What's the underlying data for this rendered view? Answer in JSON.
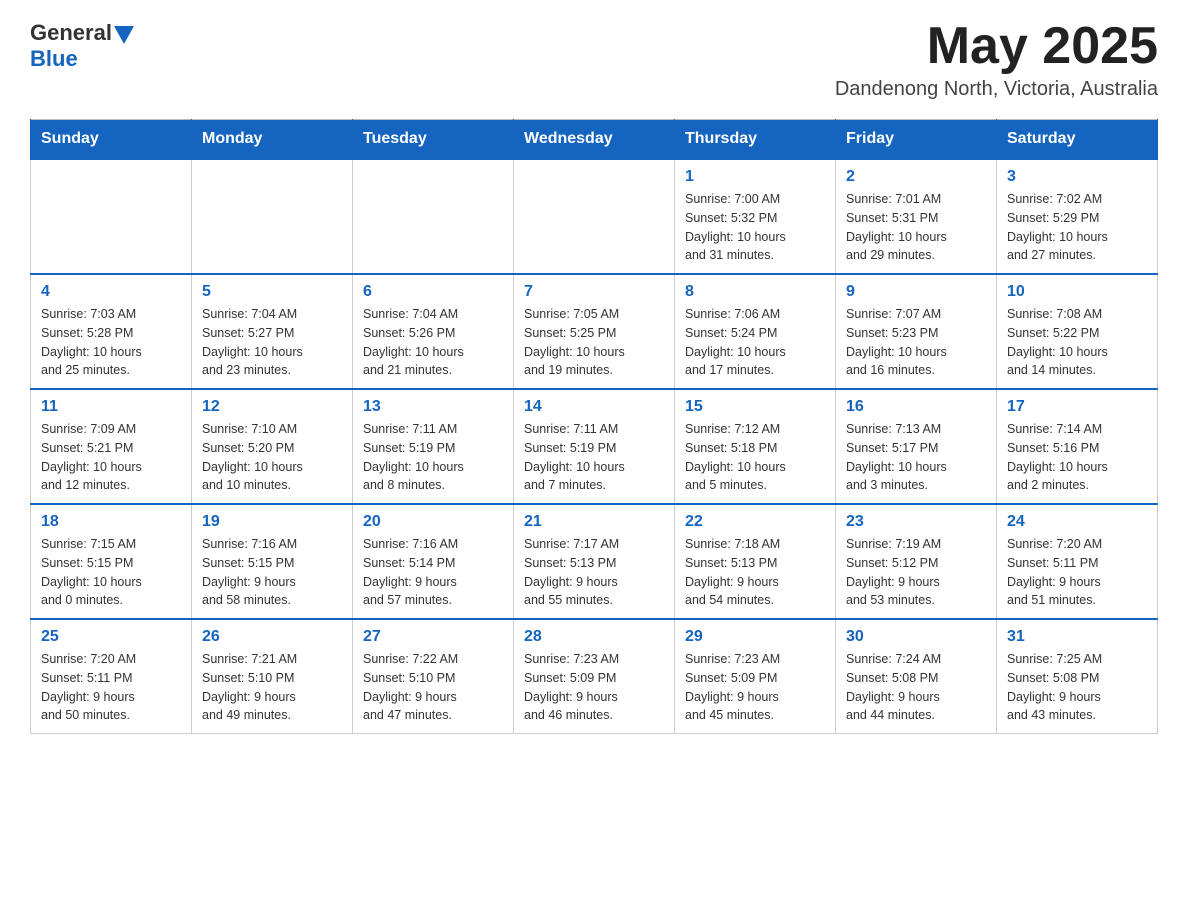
{
  "header": {
    "logo_general": "General",
    "logo_blue": "Blue",
    "month_year": "May 2025",
    "location": "Dandenong North, Victoria, Australia"
  },
  "days_of_week": [
    "Sunday",
    "Monday",
    "Tuesday",
    "Wednesday",
    "Thursday",
    "Friday",
    "Saturday"
  ],
  "weeks": [
    [
      {
        "day": "",
        "info": ""
      },
      {
        "day": "",
        "info": ""
      },
      {
        "day": "",
        "info": ""
      },
      {
        "day": "",
        "info": ""
      },
      {
        "day": "1",
        "info": "Sunrise: 7:00 AM\nSunset: 5:32 PM\nDaylight: 10 hours\nand 31 minutes."
      },
      {
        "day": "2",
        "info": "Sunrise: 7:01 AM\nSunset: 5:31 PM\nDaylight: 10 hours\nand 29 minutes."
      },
      {
        "day": "3",
        "info": "Sunrise: 7:02 AM\nSunset: 5:29 PM\nDaylight: 10 hours\nand 27 minutes."
      }
    ],
    [
      {
        "day": "4",
        "info": "Sunrise: 7:03 AM\nSunset: 5:28 PM\nDaylight: 10 hours\nand 25 minutes."
      },
      {
        "day": "5",
        "info": "Sunrise: 7:04 AM\nSunset: 5:27 PM\nDaylight: 10 hours\nand 23 minutes."
      },
      {
        "day": "6",
        "info": "Sunrise: 7:04 AM\nSunset: 5:26 PM\nDaylight: 10 hours\nand 21 minutes."
      },
      {
        "day": "7",
        "info": "Sunrise: 7:05 AM\nSunset: 5:25 PM\nDaylight: 10 hours\nand 19 minutes."
      },
      {
        "day": "8",
        "info": "Sunrise: 7:06 AM\nSunset: 5:24 PM\nDaylight: 10 hours\nand 17 minutes."
      },
      {
        "day": "9",
        "info": "Sunrise: 7:07 AM\nSunset: 5:23 PM\nDaylight: 10 hours\nand 16 minutes."
      },
      {
        "day": "10",
        "info": "Sunrise: 7:08 AM\nSunset: 5:22 PM\nDaylight: 10 hours\nand 14 minutes."
      }
    ],
    [
      {
        "day": "11",
        "info": "Sunrise: 7:09 AM\nSunset: 5:21 PM\nDaylight: 10 hours\nand 12 minutes."
      },
      {
        "day": "12",
        "info": "Sunrise: 7:10 AM\nSunset: 5:20 PM\nDaylight: 10 hours\nand 10 minutes."
      },
      {
        "day": "13",
        "info": "Sunrise: 7:11 AM\nSunset: 5:19 PM\nDaylight: 10 hours\nand 8 minutes."
      },
      {
        "day": "14",
        "info": "Sunrise: 7:11 AM\nSunset: 5:19 PM\nDaylight: 10 hours\nand 7 minutes."
      },
      {
        "day": "15",
        "info": "Sunrise: 7:12 AM\nSunset: 5:18 PM\nDaylight: 10 hours\nand 5 minutes."
      },
      {
        "day": "16",
        "info": "Sunrise: 7:13 AM\nSunset: 5:17 PM\nDaylight: 10 hours\nand 3 minutes."
      },
      {
        "day": "17",
        "info": "Sunrise: 7:14 AM\nSunset: 5:16 PM\nDaylight: 10 hours\nand 2 minutes."
      }
    ],
    [
      {
        "day": "18",
        "info": "Sunrise: 7:15 AM\nSunset: 5:15 PM\nDaylight: 10 hours\nand 0 minutes."
      },
      {
        "day": "19",
        "info": "Sunrise: 7:16 AM\nSunset: 5:15 PM\nDaylight: 9 hours\nand 58 minutes."
      },
      {
        "day": "20",
        "info": "Sunrise: 7:16 AM\nSunset: 5:14 PM\nDaylight: 9 hours\nand 57 minutes."
      },
      {
        "day": "21",
        "info": "Sunrise: 7:17 AM\nSunset: 5:13 PM\nDaylight: 9 hours\nand 55 minutes."
      },
      {
        "day": "22",
        "info": "Sunrise: 7:18 AM\nSunset: 5:13 PM\nDaylight: 9 hours\nand 54 minutes."
      },
      {
        "day": "23",
        "info": "Sunrise: 7:19 AM\nSunset: 5:12 PM\nDaylight: 9 hours\nand 53 minutes."
      },
      {
        "day": "24",
        "info": "Sunrise: 7:20 AM\nSunset: 5:11 PM\nDaylight: 9 hours\nand 51 minutes."
      }
    ],
    [
      {
        "day": "25",
        "info": "Sunrise: 7:20 AM\nSunset: 5:11 PM\nDaylight: 9 hours\nand 50 minutes."
      },
      {
        "day": "26",
        "info": "Sunrise: 7:21 AM\nSunset: 5:10 PM\nDaylight: 9 hours\nand 49 minutes."
      },
      {
        "day": "27",
        "info": "Sunrise: 7:22 AM\nSunset: 5:10 PM\nDaylight: 9 hours\nand 47 minutes."
      },
      {
        "day": "28",
        "info": "Sunrise: 7:23 AM\nSunset: 5:09 PM\nDaylight: 9 hours\nand 46 minutes."
      },
      {
        "day": "29",
        "info": "Sunrise: 7:23 AM\nSunset: 5:09 PM\nDaylight: 9 hours\nand 45 minutes."
      },
      {
        "day": "30",
        "info": "Sunrise: 7:24 AM\nSunset: 5:08 PM\nDaylight: 9 hours\nand 44 minutes."
      },
      {
        "day": "31",
        "info": "Sunrise: 7:25 AM\nSunset: 5:08 PM\nDaylight: 9 hours\nand 43 minutes."
      }
    ]
  ]
}
